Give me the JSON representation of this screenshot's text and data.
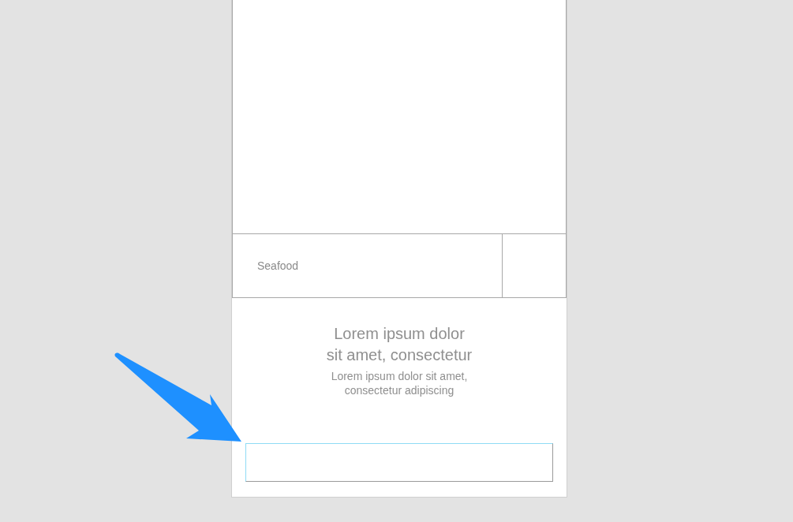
{
  "card": {
    "category": "Seafood",
    "title_lines": [
      "Lorem ipsum dolor",
      "sit amet, consectetur"
    ],
    "subtitle_lines": [
      "Lorem ipsum dolor sit amet,",
      "consectetur adipiscing"
    ]
  },
  "field": {
    "focused": true
  }
}
